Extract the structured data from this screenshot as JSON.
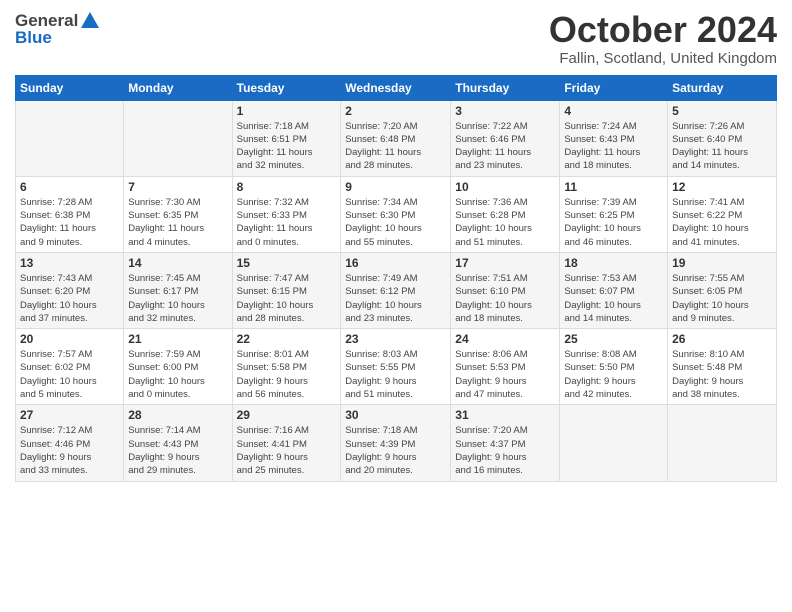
{
  "header": {
    "logo_general": "General",
    "logo_blue": "Blue",
    "month": "October 2024",
    "location": "Fallin, Scotland, United Kingdom"
  },
  "weekdays": [
    "Sunday",
    "Monday",
    "Tuesday",
    "Wednesday",
    "Thursday",
    "Friday",
    "Saturday"
  ],
  "weeks": [
    [
      {
        "day": "",
        "info": ""
      },
      {
        "day": "",
        "info": ""
      },
      {
        "day": "1",
        "info": "Sunrise: 7:18 AM\nSunset: 6:51 PM\nDaylight: 11 hours\nand 32 minutes."
      },
      {
        "day": "2",
        "info": "Sunrise: 7:20 AM\nSunset: 6:48 PM\nDaylight: 11 hours\nand 28 minutes."
      },
      {
        "day": "3",
        "info": "Sunrise: 7:22 AM\nSunset: 6:46 PM\nDaylight: 11 hours\nand 23 minutes."
      },
      {
        "day": "4",
        "info": "Sunrise: 7:24 AM\nSunset: 6:43 PM\nDaylight: 11 hours\nand 18 minutes."
      },
      {
        "day": "5",
        "info": "Sunrise: 7:26 AM\nSunset: 6:40 PM\nDaylight: 11 hours\nand 14 minutes."
      }
    ],
    [
      {
        "day": "6",
        "info": "Sunrise: 7:28 AM\nSunset: 6:38 PM\nDaylight: 11 hours\nand 9 minutes."
      },
      {
        "day": "7",
        "info": "Sunrise: 7:30 AM\nSunset: 6:35 PM\nDaylight: 11 hours\nand 4 minutes."
      },
      {
        "day": "8",
        "info": "Sunrise: 7:32 AM\nSunset: 6:33 PM\nDaylight: 11 hours\nand 0 minutes."
      },
      {
        "day": "9",
        "info": "Sunrise: 7:34 AM\nSunset: 6:30 PM\nDaylight: 10 hours\nand 55 minutes."
      },
      {
        "day": "10",
        "info": "Sunrise: 7:36 AM\nSunset: 6:28 PM\nDaylight: 10 hours\nand 51 minutes."
      },
      {
        "day": "11",
        "info": "Sunrise: 7:39 AM\nSunset: 6:25 PM\nDaylight: 10 hours\nand 46 minutes."
      },
      {
        "day": "12",
        "info": "Sunrise: 7:41 AM\nSunset: 6:22 PM\nDaylight: 10 hours\nand 41 minutes."
      }
    ],
    [
      {
        "day": "13",
        "info": "Sunrise: 7:43 AM\nSunset: 6:20 PM\nDaylight: 10 hours\nand 37 minutes."
      },
      {
        "day": "14",
        "info": "Sunrise: 7:45 AM\nSunset: 6:17 PM\nDaylight: 10 hours\nand 32 minutes."
      },
      {
        "day": "15",
        "info": "Sunrise: 7:47 AM\nSunset: 6:15 PM\nDaylight: 10 hours\nand 28 minutes."
      },
      {
        "day": "16",
        "info": "Sunrise: 7:49 AM\nSunset: 6:12 PM\nDaylight: 10 hours\nand 23 minutes."
      },
      {
        "day": "17",
        "info": "Sunrise: 7:51 AM\nSunset: 6:10 PM\nDaylight: 10 hours\nand 18 minutes."
      },
      {
        "day": "18",
        "info": "Sunrise: 7:53 AM\nSunset: 6:07 PM\nDaylight: 10 hours\nand 14 minutes."
      },
      {
        "day": "19",
        "info": "Sunrise: 7:55 AM\nSunset: 6:05 PM\nDaylight: 10 hours\nand 9 minutes."
      }
    ],
    [
      {
        "day": "20",
        "info": "Sunrise: 7:57 AM\nSunset: 6:02 PM\nDaylight: 10 hours\nand 5 minutes."
      },
      {
        "day": "21",
        "info": "Sunrise: 7:59 AM\nSunset: 6:00 PM\nDaylight: 10 hours\nand 0 minutes."
      },
      {
        "day": "22",
        "info": "Sunrise: 8:01 AM\nSunset: 5:58 PM\nDaylight: 9 hours\nand 56 minutes."
      },
      {
        "day": "23",
        "info": "Sunrise: 8:03 AM\nSunset: 5:55 PM\nDaylight: 9 hours\nand 51 minutes."
      },
      {
        "day": "24",
        "info": "Sunrise: 8:06 AM\nSunset: 5:53 PM\nDaylight: 9 hours\nand 47 minutes."
      },
      {
        "day": "25",
        "info": "Sunrise: 8:08 AM\nSunset: 5:50 PM\nDaylight: 9 hours\nand 42 minutes."
      },
      {
        "day": "26",
        "info": "Sunrise: 8:10 AM\nSunset: 5:48 PM\nDaylight: 9 hours\nand 38 minutes."
      }
    ],
    [
      {
        "day": "27",
        "info": "Sunrise: 7:12 AM\nSunset: 4:46 PM\nDaylight: 9 hours\nand 33 minutes."
      },
      {
        "day": "28",
        "info": "Sunrise: 7:14 AM\nSunset: 4:43 PM\nDaylight: 9 hours\nand 29 minutes."
      },
      {
        "day": "29",
        "info": "Sunrise: 7:16 AM\nSunset: 4:41 PM\nDaylight: 9 hours\nand 25 minutes."
      },
      {
        "day": "30",
        "info": "Sunrise: 7:18 AM\nSunset: 4:39 PM\nDaylight: 9 hours\nand 20 minutes."
      },
      {
        "day": "31",
        "info": "Sunrise: 7:20 AM\nSunset: 4:37 PM\nDaylight: 9 hours\nand 16 minutes."
      },
      {
        "day": "",
        "info": ""
      },
      {
        "day": "",
        "info": ""
      }
    ]
  ]
}
